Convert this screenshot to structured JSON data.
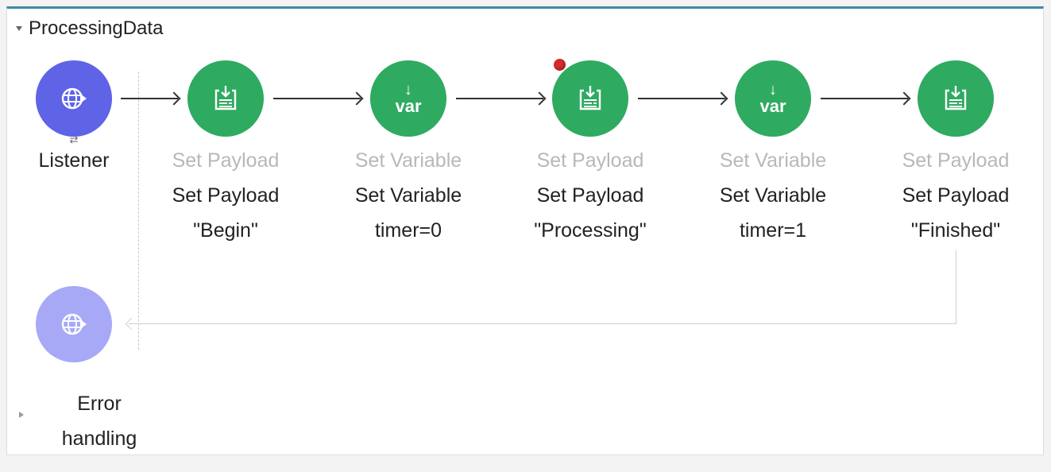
{
  "flow": {
    "title": "ProcessingData"
  },
  "source": {
    "label": "Listener",
    "icon": "globe-icon",
    "sub_icon": "⇄"
  },
  "processors": [
    {
      "type": "Set Payload",
      "label_line1": "Set Payload",
      "label_line2": "\"Begin\"",
      "icon": "set-payload-icon"
    },
    {
      "type": "Set Variable",
      "label_line1": "Set Variable",
      "label_line2": "timer=0",
      "icon": "var-icon",
      "icon_text": "var"
    },
    {
      "type": "Set Payload",
      "label_line1": "Set Payload",
      "label_line2": "\"Processing\"",
      "icon": "set-payload-icon"
    },
    {
      "type": "Set Variable",
      "label_line1": "Set Variable",
      "label_line2": "timer=1",
      "icon": "var-icon",
      "icon_text": "var"
    },
    {
      "type": "Set Payload",
      "label_line1": "Set Payload",
      "label_line2": "\"Finished\"",
      "icon": "set-payload-icon"
    }
  ],
  "error_handling": {
    "label": "Error\nhandling",
    "line1": "Error",
    "line2": "handling"
  },
  "colors": {
    "processor": "#2faa61",
    "source": "#5f63e6",
    "source_faded": "#a7a9f7",
    "breakpoint": "#d32c2c",
    "accent_border": "#3f88a5"
  },
  "breakpoint_on_processor_index": 2
}
